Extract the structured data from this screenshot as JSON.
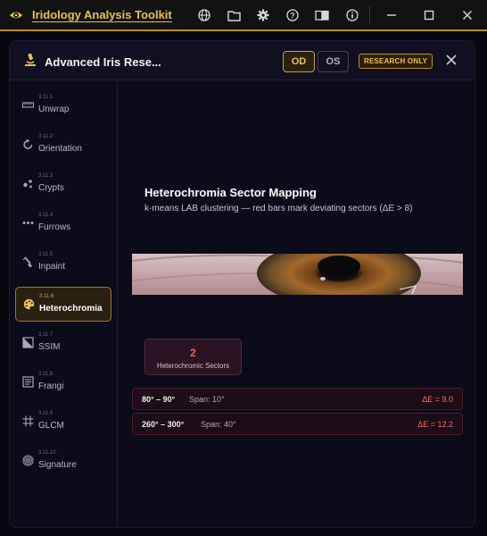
{
  "app": {
    "title": "Iridology Analysis Toolkit",
    "toolbar_icons": [
      "globe-icon",
      "folder-icon",
      "gear-icon",
      "help-icon",
      "book-icon",
      "info-icon"
    ],
    "window_controls": [
      "minimize-icon",
      "maximize-icon",
      "close-icon"
    ]
  },
  "dialog": {
    "title": "Advanced Iris Rese...",
    "eye_toggle": {
      "od": "OD",
      "os": "OS",
      "selected": "OD"
    },
    "badge": "RESEARCH ONLY"
  },
  "sidebar": {
    "items": [
      {
        "number": "3.11.1",
        "label": "Unwrap",
        "icon": "ruler-icon"
      },
      {
        "number": "3.11.2",
        "label": "Orientation",
        "icon": "rotate-icon"
      },
      {
        "number": "3.11.3",
        "label": "Crypts",
        "icon": "dots-cluster-icon"
      },
      {
        "number": "3.11.4",
        "label": "Furrows",
        "icon": "dots-line-icon"
      },
      {
        "number": "3.11.5",
        "label": "Inpaint",
        "icon": "brush-icon"
      },
      {
        "number": "3.11.6",
        "label": "Heterochromia",
        "icon": "palette-icon",
        "active": true
      },
      {
        "number": "3.11.7",
        "label": "SSIM",
        "icon": "compare-icon"
      },
      {
        "number": "3.11.8",
        "label": "Frangi",
        "icon": "filter-icon"
      },
      {
        "number": "3.11.9",
        "label": "GLCM",
        "icon": "grid-icon"
      },
      {
        "number": "3.11.10",
        "label": "Signature",
        "icon": "fingerprint-icon"
      }
    ]
  },
  "main": {
    "title": "Heterochromia Sector Mapping",
    "subtitle": "k-means LAB clustering — red bars mark deviating sectors (ΔE > 8)",
    "stat": {
      "value": "2",
      "label": "Heterochromic Sectors"
    },
    "sectors": [
      {
        "range": "80° – 90°",
        "span": "Span: 10°",
        "delta": "ΔE = 9.0"
      },
      {
        "range": "260° – 300°",
        "span": "Span: 40°",
        "delta": "ΔE = 12.2"
      }
    ]
  },
  "colors": {
    "accent": "#e8c34a",
    "alert": "#ff5a5a",
    "background": "#0b0b1a"
  }
}
